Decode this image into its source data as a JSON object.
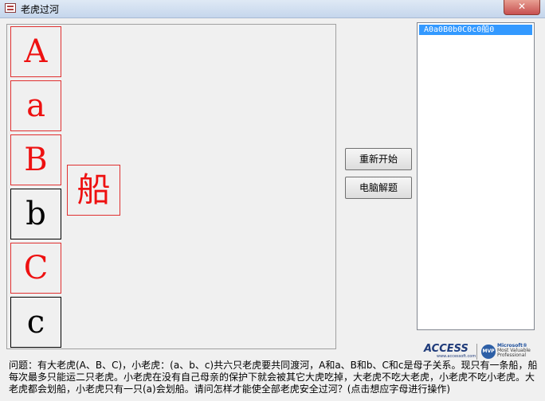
{
  "window": {
    "title": "老虎过河",
    "close_glyph": "✕"
  },
  "tiles": [
    "A",
    "a",
    "B",
    "b",
    "C",
    "c"
  ],
  "boat": {
    "label": "船"
  },
  "buttons": {
    "restart": "重新开始",
    "solve": "电脑解题"
  },
  "history": {
    "items": [
      "A0a0B0b0C0c0船0"
    ]
  },
  "logos": {
    "access": "ACCESS",
    "access_url": "www.accessoft.com",
    "mvp_badge": "MVP",
    "mvp_line1": "Microsoft®",
    "mvp_line2": "Most Valuable",
    "mvp_line3": "Professional"
  },
  "question_text": "问题：有大老虎(A、B、C)，小老虎：(a、b、c)共六只老虎要共同渡河，A和a、B和b、C和c是母子关系。现只有一条船，船每次最多只能运二只老虎。小老虎在没有自己母亲的保护下就会被其它大虎吃掉，大老虎不吃大老虎，小老虎不吃小老虎。大老虎都会划船，小老虎只有一只(a)会划船。请问怎样才能使全部老虎安全过河？(点击想应字母进行操作)",
  "colors": {
    "selected_tile": "#ee1111",
    "normal_tile": "#000000",
    "list_highlight": "#3399ff"
  }
}
